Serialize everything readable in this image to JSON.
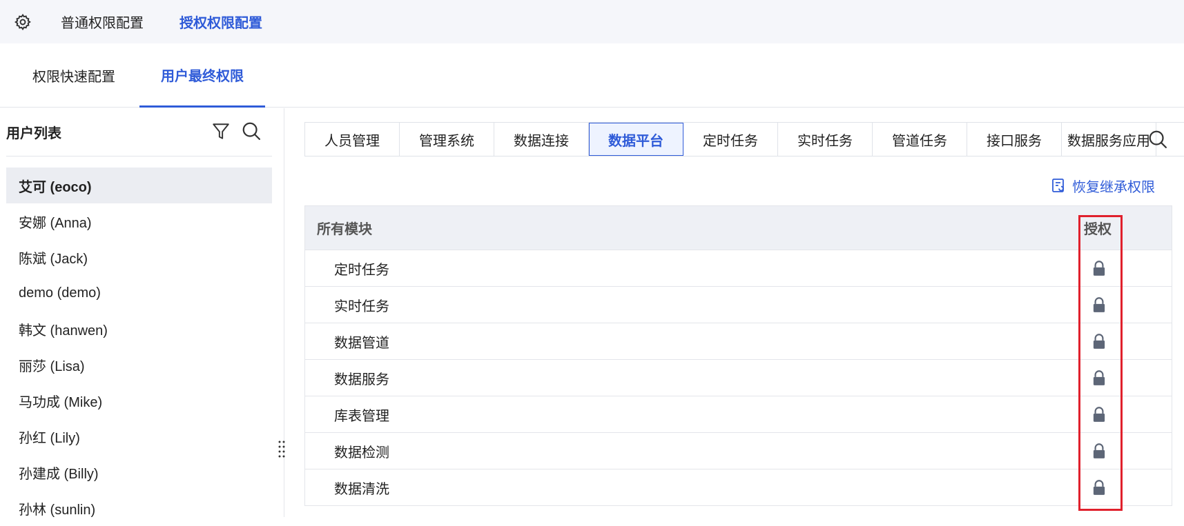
{
  "top_nav": {
    "settings_icon": "gear-icon",
    "tabs": [
      {
        "label": "普通权限配置",
        "active": false
      },
      {
        "label": "授权权限配置",
        "active": true
      }
    ]
  },
  "sub_tabs": [
    {
      "label": "权限快速配置",
      "active": false
    },
    {
      "label": "用户最终权限",
      "active": true
    }
  ],
  "user_panel": {
    "title": "用户列表",
    "users": [
      {
        "label": "艾可 (eoco)",
        "active": true
      },
      {
        "label": "安娜 (Anna)",
        "active": false
      },
      {
        "label": "陈斌 (Jack)",
        "active": false
      },
      {
        "label": "demo (demo)",
        "active": false
      },
      {
        "label": "韩文 (hanwen)",
        "active": false
      },
      {
        "label": "丽莎 (Lisa)",
        "active": false
      },
      {
        "label": "马功成 (Mike)",
        "active": false
      },
      {
        "label": "孙红 (Lily)",
        "active": false
      },
      {
        "label": "孙建成 (Billy)",
        "active": false
      },
      {
        "label": "孙林 (sunlin)",
        "active": false
      }
    ]
  },
  "module_tabs": [
    {
      "label": "人员管理",
      "active": false
    },
    {
      "label": "管理系统",
      "active": false
    },
    {
      "label": "数据连接",
      "active": false
    },
    {
      "label": "数据平台",
      "active": true
    },
    {
      "label": "定时任务",
      "active": false
    },
    {
      "label": "实时任务",
      "active": false
    },
    {
      "label": "管道任务",
      "active": false
    },
    {
      "label": "接口服务",
      "active": false
    },
    {
      "label": "数据服务应用",
      "active": false
    }
  ],
  "restore_label": "恢复继承权限",
  "table": {
    "col_module": "所有模块",
    "col_auth": "授权",
    "rows": [
      {
        "name": "定时任务",
        "auth_icon": "lock-icon"
      },
      {
        "name": "实时任务",
        "auth_icon": "lock-icon"
      },
      {
        "name": "数据管道",
        "auth_icon": "lock-icon"
      },
      {
        "name": "数据服务",
        "auth_icon": "lock-icon"
      },
      {
        "name": "库表管理",
        "auth_icon": "lock-icon"
      },
      {
        "name": "数据检测",
        "auth_icon": "lock-icon"
      },
      {
        "name": "数据清洗",
        "auth_icon": "lock-icon"
      }
    ]
  },
  "colors": {
    "accent": "#2f5bd8",
    "highlight": "#e0202c",
    "lock": "#5d6677"
  }
}
